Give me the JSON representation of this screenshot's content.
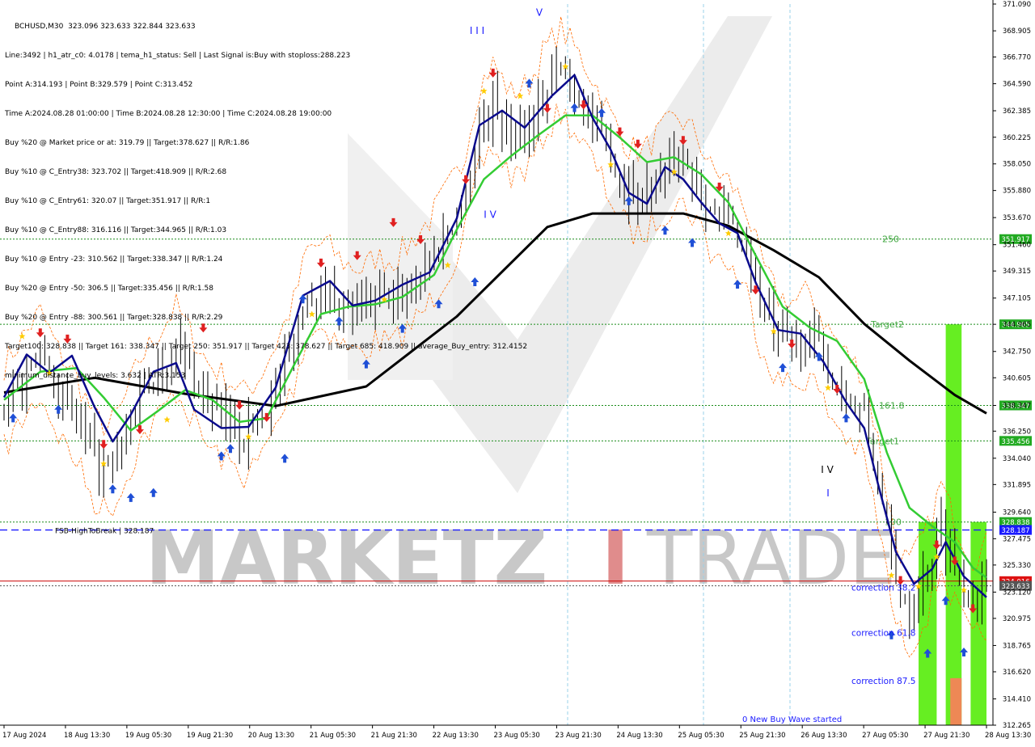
{
  "window": {
    "symbol_title": "BCHUSD,M30  323.096 323.633 322.844 323.633"
  },
  "info_lines": [
    "Line:3492 | h1_atr_c0: 4.0178 | tema_h1_status: Sell | Last Signal is:Buy with stoploss:288.223",
    "Point A:314.193 | Point B:329.579 | Point C:313.452",
    "Time A:2024.08.28 01:00:00 | Time B:2024.08.28 12:30:00 | Time C:2024.08.28 19:00:00",
    "Buy %20 @ Market price or at: 319.79 || Target:378.627 || R/R:1.86",
    "Buy %10 @ C_Entry38: 323.702 || Target:418.909 || R/R:2.68",
    "Buy %10 @ C_Entry61: 320.07 || Target:351.917 || R/R:1",
    "Buy %10 @ C_Entry88: 316.116 || Target:344.965 || R/R:1.03",
    "Buy %10 @ Entry -23: 310.562 || Target:338.347 || R/R:1.24",
    "Buy %20 @ Entry -50: 306.5 || Target:335.456 || R/R:1.58",
    "Buy %20 @ Entry -88: 300.561 || Target:328.838 || R/R:2.29",
    "Target100: 328.838 || Target 161: 338.347 || Target 250: 351.917 || Target 423: 378.627 || Target 685: 418.909 || average_Buy_entry: 312.4152",
    "minimum_distance_buy_levels: 3.632 | ATR:3.153"
  ],
  "watermark": {
    "text_left": "MARKETZ",
    "text_i": "I",
    "text_right": "TRADE",
    "color_main": "#c8c8c8",
    "color_i": "#e08c8c"
  },
  "colors": {
    "background": "#ffffff",
    "candle": "#000000",
    "ma_black": "#000000",
    "ma_blue": "#0a0a8c",
    "ma_green": "#33cc33",
    "band_orange": "#ff6a00",
    "level_green": "#1a8c1a",
    "level_blue": "#1a1aff",
    "level_red": "#cc0000",
    "bar_green": "#66ee22",
    "bar_orange": "#ee8855",
    "label_green_bg": "#22aa22",
    "label_blue_bg": "#1a1aff",
    "label_red_bg": "#dd1111",
    "label_gray_bg": "#555555",
    "grid_vline": "#9ad0e8",
    "arrow_up": "#1f4fd6",
    "arrow_down": "#e02020",
    "star": "#ffcc00"
  },
  "chart_data": {
    "type": "candlestick",
    "symbol": "BCHUSD",
    "timeframe": "M30",
    "ylim": [
      312.265,
      371.09
    ],
    "y_ticks": [
      "371.090",
      "368.905",
      "366.770",
      "364.590",
      "362.385",
      "360.225",
      "358.050",
      "355.880",
      "353.670",
      "351.460",
      "349.315",
      "347.105",
      "344.965",
      "342.750",
      "340.605",
      "338.347",
      "336.250",
      "334.040",
      "331.895",
      "329.640",
      "327.475",
      "325.330",
      "323.120",
      "320.975",
      "318.765",
      "316.620",
      "314.410",
      "312.265"
    ],
    "x_ticks": [
      "17 Aug 2024",
      "18 Aug 13:30",
      "19 Aug 05:30",
      "19 Aug 21:30",
      "20 Aug 13:30",
      "21 Aug 05:30",
      "21 Aug 21:30",
      "22 Aug 13:30",
      "23 Aug 05:30",
      "23 Aug 21:30",
      "24 Aug 13:30",
      "25 Aug 05:30",
      "25 Aug 21:30",
      "26 Aug 13:30",
      "27 Aug 05:30",
      "27 Aug 21:30",
      "28 Aug 13:30"
    ],
    "levels": [
      {
        "label": "250",
        "value": 351.917,
        "tag": "351.917",
        "style": "dotted",
        "color": "#1a8c1a"
      },
      {
        "label": "Target2",
        "value": 344.965,
        "tag": "344.965",
        "style": "dotted",
        "color": "#1a8c1a"
      },
      {
        "label": "161.8",
        "value": 338.347,
        "tag": "338.347",
        "style": "dotted",
        "color": "#1a8c1a"
      },
      {
        "label": "Target1",
        "value": 335.456,
        "tag": "335.456",
        "style": "dotted",
        "color": "#1a8c1a"
      },
      {
        "label": "100",
        "value": 328.838,
        "tag": "328.838",
        "style": "dotted",
        "color": "#1a8c1a"
      },
      {
        "label": "FSB-HighToBreak | 328.187",
        "value": 328.187,
        "tag": "328.187",
        "style": "dashed",
        "color": "#1a1aff"
      },
      {
        "label": "",
        "value": 324.016,
        "tag": "324.016",
        "style": "solid",
        "color": "#cc0000"
      },
      {
        "label": "",
        "value": 323.633,
        "tag": "323.633",
        "style": "dotted",
        "color": "#555555"
      }
    ],
    "annotations": [
      {
        "text": "I I I",
        "x": "23 Aug 21:30",
        "y": 368.9
      },
      {
        "text": "V",
        "x": "24 Aug 13:30",
        "y": 370.4
      },
      {
        "text": "I V",
        "x": "23 Aug 21:30",
        "y": 353.9
      },
      {
        "text": "I V",
        "x": "27 Aug 21:30",
        "y": 333.1
      },
      {
        "text": "I",
        "x": "27 Aug 21:30",
        "y": 331.2
      },
      {
        "text": "correction 38.2",
        "x": "28 Aug 13:30",
        "y": 323.5
      },
      {
        "text": "correction 61.8",
        "x": "28 Aug 13:30",
        "y": 319.8
      },
      {
        "text": "correction 87.5",
        "x": "28 Aug 13:30",
        "y": 315.9
      },
      {
        "text": "0 New Buy Wave started",
        "x": "27 Aug 21:30",
        "y": 312.8
      }
    ],
    "close_path": [
      [
        0,
        338.2
      ],
      [
        4,
        340.5
      ],
      [
        8,
        342.6
      ],
      [
        12,
        339.4
      ],
      [
        16,
        337.2
      ],
      [
        20,
        333.9
      ],
      [
        23,
        333.2
      ],
      [
        26,
        334.8
      ],
      [
        30,
        338.7
      ],
      [
        34,
        340.8
      ],
      [
        38,
        343.0
      ],
      [
        41,
        341.0
      ],
      [
        45,
        338.4
      ],
      [
        49,
        337.2
      ],
      [
        53,
        336.0
      ],
      [
        56,
        337.0
      ],
      [
        60,
        339.9
      ],
      [
        64,
        343.4
      ],
      [
        67,
        347.6
      ],
      [
        71,
        348.2
      ],
      [
        75,
        346.6
      ],
      [
        79,
        346.0
      ],
      [
        82,
        347.0
      ],
      [
        86,
        346.8
      ],
      [
        90,
        348.3
      ],
      [
        94,
        350.1
      ],
      [
        97,
        352.0
      ],
      [
        101,
        354.4
      ],
      [
        105,
        361.0
      ],
      [
        108,
        362.8
      ],
      [
        112,
        360.4
      ],
      [
        116,
        361.2
      ],
      [
        119,
        363.7
      ],
      [
        123,
        365.7
      ],
      [
        127,
        363.6
      ],
      [
        130,
        361.7
      ],
      [
        134,
        358.6
      ],
      [
        138,
        356.0
      ],
      [
        141,
        355.6
      ],
      [
        145,
        357.3
      ],
      [
        149,
        358.4
      ],
      [
        153,
        357.0
      ],
      [
        156,
        354.3
      ],
      [
        160,
        353.3
      ],
      [
        164,
        351.0
      ],
      [
        167,
        346.8
      ],
      [
        171,
        343.8
      ],
      [
        175,
        343.4
      ],
      [
        178,
        344.3
      ],
      [
        182,
        341.2
      ],
      [
        186,
        339.2
      ],
      [
        190,
        337.4
      ],
      [
        193,
        332.2
      ],
      [
        197,
        323.7
      ],
      [
        200,
        322.0
      ],
      [
        204,
        324.8
      ],
      [
        207,
        328.5
      ],
      [
        210,
        325.4
      ],
      [
        214,
        322.5
      ],
      [
        217,
        323.6
      ]
    ],
    "ma_black": [
      [
        0,
        339.4
      ],
      [
        20,
        340.6
      ],
      [
        40,
        339.3
      ],
      [
        60,
        338.3
      ],
      [
        80,
        339.9
      ],
      [
        100,
        345.6
      ],
      [
        120,
        352.9
      ],
      [
        130,
        354.0
      ],
      [
        140,
        354.0
      ],
      [
        150,
        354.0
      ],
      [
        160,
        353.0
      ],
      [
        170,
        351.0
      ],
      [
        180,
        348.8
      ],
      [
        190,
        345.0
      ],
      [
        200,
        342.0
      ],
      [
        210,
        339.2
      ],
      [
        217,
        337.7
      ]
    ],
    "ma_blue": [
      [
        0,
        339.0
      ],
      [
        5,
        342.5
      ],
      [
        10,
        341.0
      ],
      [
        15,
        342.4
      ],
      [
        20,
        338.2
      ],
      [
        24,
        335.4
      ],
      [
        28,
        337.6
      ],
      [
        33,
        341.1
      ],
      [
        38,
        341.8
      ],
      [
        42,
        338.0
      ],
      [
        48,
        336.5
      ],
      [
        54,
        336.6
      ],
      [
        60,
        339.8
      ],
      [
        66,
        347.3
      ],
      [
        72,
        348.5
      ],
      [
        77,
        346.5
      ],
      [
        82,
        346.9
      ],
      [
        88,
        348.2
      ],
      [
        94,
        349.2
      ],
      [
        100,
        353.6
      ],
      [
        105,
        361.2
      ],
      [
        110,
        362.4
      ],
      [
        115,
        361.0
      ],
      [
        121,
        363.6
      ],
      [
        126,
        365.3
      ],
      [
        130,
        361.8
      ],
      [
        134,
        359.2
      ],
      [
        138,
        355.7
      ],
      [
        142,
        354.8
      ],
      [
        146,
        357.8
      ],
      [
        150,
        356.8
      ],
      [
        154,
        354.9
      ],
      [
        158,
        353.2
      ],
      [
        162,
        352.4
      ],
      [
        166,
        348.4
      ],
      [
        171,
        344.5
      ],
      [
        176,
        344.2
      ],
      [
        181,
        341.9
      ],
      [
        186,
        338.6
      ],
      [
        190,
        336.5
      ],
      [
        193,
        332.0
      ],
      [
        197,
        326.4
      ],
      [
        201,
        323.8
      ],
      [
        205,
        325.0
      ],
      [
        208,
        327.2
      ],
      [
        212,
        324.4
      ],
      [
        217,
        322.7
      ]
    ],
    "ma_green": [
      [
        0,
        338.8
      ],
      [
        8,
        341.1
      ],
      [
        16,
        341.4
      ],
      [
        22,
        339.0
      ],
      [
        28,
        336.3
      ],
      [
        34,
        337.9
      ],
      [
        40,
        339.6
      ],
      [
        46,
        338.8
      ],
      [
        52,
        337.0
      ],
      [
        58,
        337.3
      ],
      [
        64,
        341.6
      ],
      [
        70,
        345.8
      ],
      [
        76,
        346.4
      ],
      [
        82,
        346.6
      ],
      [
        88,
        347.2
      ],
      [
        95,
        349.0
      ],
      [
        100,
        352.7
      ],
      [
        106,
        356.8
      ],
      [
        112,
        358.7
      ],
      [
        118,
        360.4
      ],
      [
        124,
        362.0
      ],
      [
        130,
        362.0
      ],
      [
        136,
        360.2
      ],
      [
        142,
        358.2
      ],
      [
        148,
        358.6
      ],
      [
        154,
        357.2
      ],
      [
        160,
        354.9
      ],
      [
        166,
        350.6
      ],
      [
        172,
        346.4
      ],
      [
        178,
        344.7
      ],
      [
        184,
        343.6
      ],
      [
        190,
        340.5
      ],
      [
        195,
        334.5
      ],
      [
        200,
        330.0
      ],
      [
        205,
        328.5
      ],
      [
        210,
        327.2
      ],
      [
        214,
        325.1
      ],
      [
        217,
        324.3
      ]
    ],
    "green_bars": [
      {
        "x_start": 202,
        "x_end": 206,
        "y_low": 312.265,
        "y_high": 328.838
      },
      {
        "x_start": 208,
        "x_end": 211.5,
        "y_low": 312.265,
        "y_high": 344.965
      },
      {
        "x_start": 213.5,
        "x_end": 217,
        "y_low": 312.265,
        "y_high": 328.838
      }
    ],
    "orange_bar": {
      "x_start": 209,
      "x_end": 211.5,
      "y_low": 312.265,
      "y_high": 316.1
    },
    "n_bars": 218,
    "up_arrows": [
      [
        2,
        337.7
      ],
      [
        12,
        338.4
      ],
      [
        24,
        331.9
      ],
      [
        28,
        331.2
      ],
      [
        33,
        331.6
      ],
      [
        48,
        334.6
      ],
      [
        50,
        335.2
      ],
      [
        62,
        334.4
      ],
      [
        66,
        347.4
      ],
      [
        74,
        345.6
      ],
      [
        80,
        342.1
      ],
      [
        88,
        345.0
      ],
      [
        96,
        347.0
      ],
      [
        104,
        348.8
      ],
      [
        116,
        365.0
      ],
      [
        126,
        363.0
      ],
      [
        132,
        362.6
      ],
      [
        138,
        355.4
      ],
      [
        146,
        353.0
      ],
      [
        152,
        352.0
      ],
      [
        162,
        348.6
      ],
      [
        172,
        341.8
      ],
      [
        180,
        342.7
      ],
      [
        186,
        337.7
      ],
      [
        196,
        320.0
      ],
      [
        204,
        318.5
      ],
      [
        208,
        322.8
      ],
      [
        212,
        318.6
      ]
    ],
    "down_arrows": [
      [
        8,
        343.9
      ],
      [
        14,
        343.4
      ],
      [
        22,
        334.8
      ],
      [
        30,
        336.0
      ],
      [
        44,
        344.3
      ],
      [
        52,
        338.0
      ],
      [
        58,
        337.0
      ],
      [
        70,
        349.6
      ],
      [
        78,
        350.2
      ],
      [
        86,
        352.9
      ],
      [
        92,
        351.5
      ],
      [
        102,
        356.4
      ],
      [
        108,
        365.1
      ],
      [
        120,
        362.2
      ],
      [
        128,
        362.5
      ],
      [
        136,
        360.3
      ],
      [
        140,
        359.3
      ],
      [
        150,
        359.6
      ],
      [
        158,
        355.8
      ],
      [
        166,
        347.4
      ],
      [
        174,
        343.0
      ],
      [
        184,
        339.3
      ],
      [
        198,
        323.7
      ],
      [
        206,
        326.6
      ],
      [
        210,
        325.3
      ],
      [
        214,
        321.4
      ]
    ],
    "stars": [
      [
        4,
        344.0
      ],
      [
        10,
        341.0
      ],
      [
        22,
        333.6
      ],
      [
        36,
        337.2
      ],
      [
        54,
        335.8
      ],
      [
        68,
        345.8
      ],
      [
        84,
        347.0
      ],
      [
        98,
        349.8
      ],
      [
        106,
        364.0
      ],
      [
        114,
        363.6
      ],
      [
        124,
        366.0
      ],
      [
        134,
        358.0
      ],
      [
        148,
        357.4
      ],
      [
        160,
        352.4
      ],
      [
        170,
        344.4
      ],
      [
        182,
        339.8
      ],
      [
        196,
        324.5
      ],
      [
        202,
        323.6
      ],
      [
        206,
        326.0
      ],
      [
        212,
        323.3
      ]
    ]
  }
}
